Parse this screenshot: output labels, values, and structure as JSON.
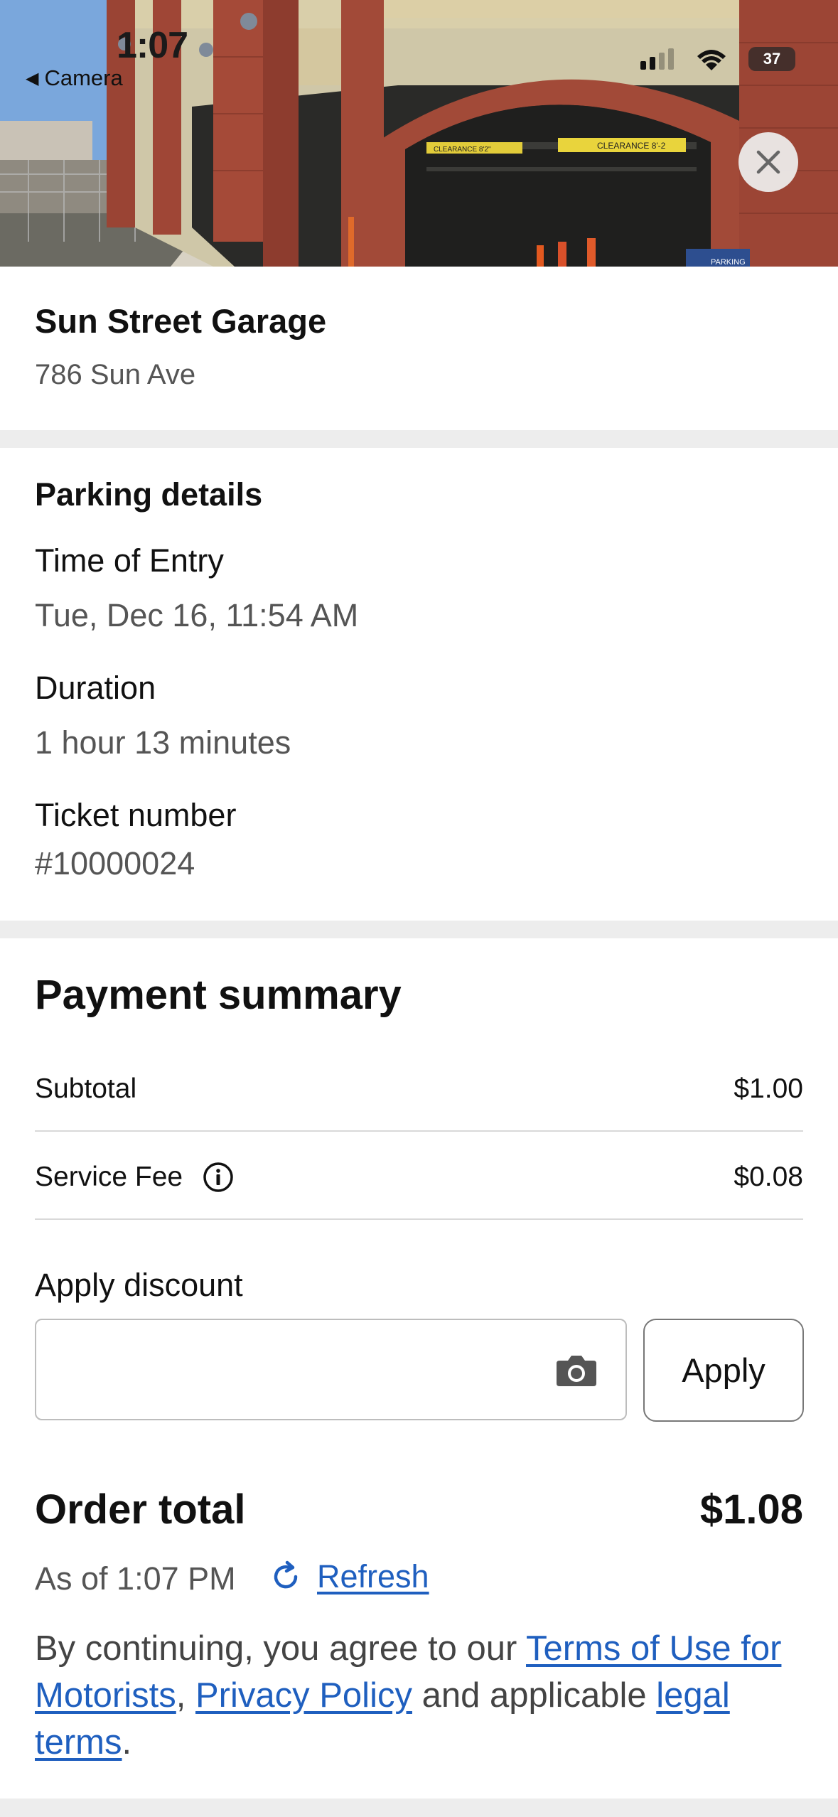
{
  "status_bar": {
    "time": "1:07",
    "back_label": "Camera",
    "battery": "37"
  },
  "location": {
    "name": "Sun Street Garage",
    "address": "786 Sun Ave"
  },
  "details": {
    "title": "Parking details",
    "entry_label": "Time of Entry",
    "entry_value": "Tue, Dec 16, 11:54 AM",
    "duration_label": "Duration",
    "duration_value": "1 hour 13 minutes",
    "ticket_label": "Ticket number",
    "ticket_value": "#10000024"
  },
  "payment": {
    "title": "Payment summary",
    "subtotal_label": "Subtotal",
    "subtotal_value": "$1.00",
    "fee_label": "Service Fee",
    "fee_value": "$0.08",
    "discount_label": "Apply discount",
    "discount_value": "",
    "discount_placeholder": "",
    "apply_label": "Apply",
    "total_label": "Order total",
    "total_value": "$1.08",
    "as_of": "As of 1:07 PM",
    "refresh_label": "Refresh"
  },
  "legal": {
    "prefix": "By continuing, you agree to our ",
    "terms_link": "Terms of Use for Motorists",
    "comma": ", ",
    "privacy_link": "Privacy Policy",
    "middle": " and applicable ",
    "legal_link": "legal terms",
    "suffix": "."
  },
  "photo_signs": {
    "clearance_left": "CLEARANCE 8'2\"",
    "clearance_right": "CLEARANCE 8'-2",
    "parking": "PARKING"
  },
  "colors": {
    "link": "#1f5fbf",
    "background": "#ededed",
    "card": "#ffffff"
  }
}
